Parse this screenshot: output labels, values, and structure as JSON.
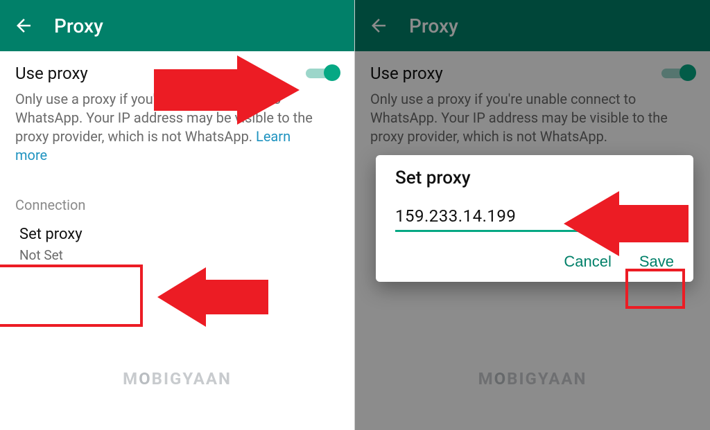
{
  "left": {
    "header": {
      "title": "Proxy"
    },
    "use_proxy_label": "Use proxy",
    "description_prefix": "Only use a proxy if you're unable connect to WhatsApp. Your IP address may be visible to the proxy provider, which is not WhatsApp. ",
    "learn_more": "Learn more",
    "connection_label": "Connection",
    "set_proxy_title": "Set proxy",
    "set_proxy_status": "Not Set"
  },
  "right": {
    "header": {
      "title": "Proxy"
    },
    "use_proxy_label": "Use proxy",
    "description_prefix": "Only use a proxy if you're unable connect to WhatsApp. Your IP address may be visible to the proxy provider, which is not WhatsApp. ",
    "dialog": {
      "title": "Set proxy",
      "value": "159.233.14.199",
      "cancel": "Cancel",
      "save": "Save"
    }
  },
  "watermark_a": "M",
  "watermark_b": "O",
  "watermark_c": "BIGYAAN"
}
